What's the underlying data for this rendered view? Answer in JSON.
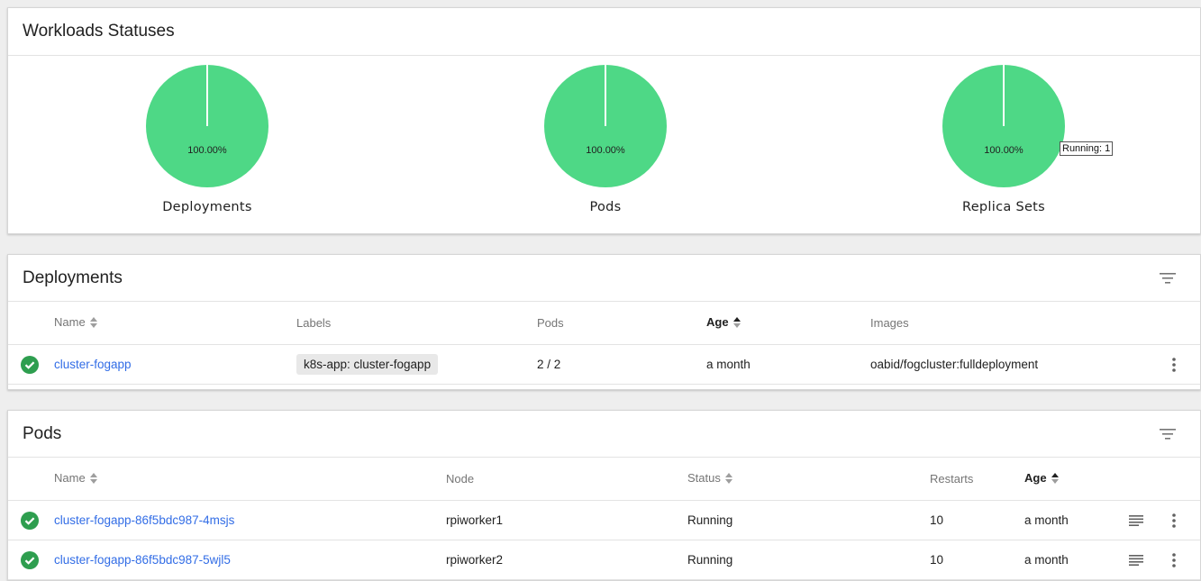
{
  "workloads": {
    "title": "Workloads Statuses",
    "charts": [
      {
        "label": "Deployments",
        "percent_label": "100.00%",
        "running_fraction": 1.0
      },
      {
        "label": "Pods",
        "percent_label": "100.00%",
        "running_fraction": 1.0
      },
      {
        "label": "Replica Sets",
        "percent_label": "100.00%",
        "running_fraction": 1.0,
        "tooltip": "Running: 1"
      }
    ],
    "running_color": "#4ed886"
  },
  "deployments": {
    "title": "Deployments",
    "columns": {
      "name": "Name",
      "labels": "Labels",
      "pods": "Pods",
      "age": "Age",
      "images": "Images"
    },
    "rows": [
      {
        "name": "cluster-fogapp",
        "label_chip": "k8s-app: cluster-fogapp",
        "pods": "2 / 2",
        "age": "a month",
        "image": "oabid/fogcluster:fulldeployment"
      }
    ]
  },
  "pods": {
    "title": "Pods",
    "columns": {
      "name": "Name",
      "node": "Node",
      "status": "Status",
      "restarts": "Restarts",
      "age": "Age"
    },
    "rows": [
      {
        "name": "cluster-fogapp-86f5bdc987-4msjs",
        "node": "rpiworker1",
        "status": "Running",
        "restarts": "10",
        "age": "a month"
      },
      {
        "name": "cluster-fogapp-86f5bdc987-5wjl5",
        "node": "rpiworker2",
        "status": "Running",
        "restarts": "10",
        "age": "a month"
      }
    ]
  },
  "colors": {
    "success": "#2e9e4f",
    "link": "#326de6"
  }
}
